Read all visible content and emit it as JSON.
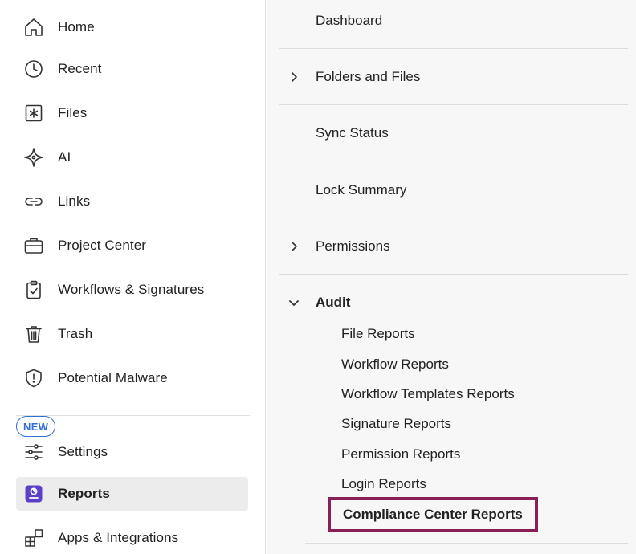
{
  "sidebar": {
    "items": [
      {
        "label": "Home",
        "icon": "home-icon"
      },
      {
        "label": "Recent",
        "icon": "clock-icon"
      },
      {
        "label": "Files",
        "icon": "files-icon"
      },
      {
        "label": "AI",
        "icon": "ai-sparkle-icon"
      },
      {
        "label": "Links",
        "icon": "link-icon"
      },
      {
        "label": "Project Center",
        "icon": "briefcase-icon"
      },
      {
        "label": "Workflows & Signatures",
        "icon": "clipboard-check-icon"
      },
      {
        "label": "Trash",
        "icon": "trash-icon"
      },
      {
        "label": "Potential Malware",
        "icon": "shield-alert-icon"
      },
      {
        "label": "Settings",
        "icon": "sliders-icon"
      },
      {
        "label": "Reports",
        "icon": "reports-icon",
        "active": true
      },
      {
        "label": "Apps & Integrations",
        "icon": "apps-icon"
      }
    ],
    "new_badge": "NEW"
  },
  "reports_menu": {
    "rows": [
      {
        "label": "Dashboard",
        "expandable": false
      },
      {
        "label": "Folders and Files",
        "expandable": true,
        "expanded": false
      },
      {
        "label": "Sync Status",
        "expandable": false
      },
      {
        "label": "Lock Summary",
        "expandable": false
      },
      {
        "label": "Permissions",
        "expandable": true,
        "expanded": false
      },
      {
        "label": "Audit",
        "expandable": true,
        "expanded": true
      }
    ],
    "audit_items": [
      "File Reports",
      "Workflow Reports",
      "Workflow Templates Reports",
      "Signature Reports",
      "Permission Reports",
      "Login Reports",
      "Compliance Center Reports"
    ],
    "highlighted_item": "Compliance Center Reports"
  },
  "colors": {
    "accent_purple": "#5b3fc4",
    "badge_blue": "#2f6fd6",
    "highlight_border": "#8a1f58"
  }
}
